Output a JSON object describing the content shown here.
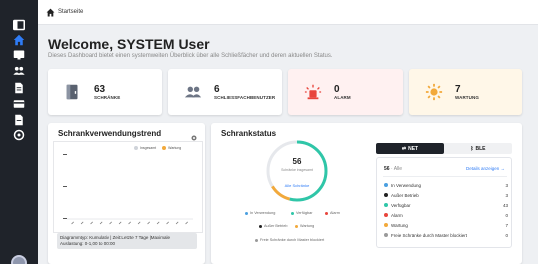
{
  "breadcrumb": {
    "home": "Startseite"
  },
  "header": {
    "title": "Welcome, SYSTEM User",
    "subtitle": "Dieses Dashboard bietet einen systemweiten Überblick über alle Schließfächer und deren aktuellen Status."
  },
  "stats": [
    {
      "value": "63",
      "label": "SCHRÄNKE",
      "icon": "locker-icon"
    },
    {
      "value": "6",
      "label": "SCHLIESSFACHBENUTZER",
      "icon": "users-icon"
    },
    {
      "value": "0",
      "label": "ALARM",
      "icon": "alarm-icon"
    },
    {
      "value": "7",
      "label": "WARTUNG",
      "icon": "maintenance-icon"
    }
  ],
  "trend": {
    "title": "Schrankverwendungstrend",
    "legend": [
      "Insgesamt",
      "Wartung"
    ],
    "note": "Diagrammtyp: Kumulativ | Zeit:Letzte 7 Tage |Maximale Auslastung: 0-1,00 to 00:00"
  },
  "status": {
    "title": "Schrankstatus",
    "donut_total": "56",
    "donut_sub": "Schränke insgesamt",
    "donut_link": "Alle Schränke",
    "donut_fraction_in_use": 0.05,
    "legend": [
      "In Verwendung",
      "Verfügbar",
      "Alarm",
      "Außer Betrieb",
      "Wartung",
      "Freie Schränke durch Master blockiert"
    ],
    "tabs": [
      "NET",
      "BLE"
    ],
    "box_count": "56",
    "box_label": "Alle",
    "details": "Details anzeigen →",
    "rows": [
      {
        "label": "In Verwendung",
        "value": "3",
        "color": "#4a9fe0"
      },
      {
        "label": "Außer Betrieb",
        "value": "3",
        "color": "#222222"
      },
      {
        "label": "Verfügbar",
        "value": "43",
        "color": "#2fc6a8"
      },
      {
        "label": "Alarm",
        "value": "0",
        "color": "#e8453c"
      },
      {
        "label": "Wartung",
        "value": "7",
        "color": "#f2a93b"
      },
      {
        "label": "Freie Schränke durch Master blockiert",
        "value": "0",
        "color": "#9a9a9a"
      }
    ]
  },
  "colors": {
    "accent": "#2f7cf6",
    "sidebar": "#1f232a",
    "teal": "#2fc6a8",
    "orange": "#f2a93b",
    "red": "#e8453c"
  }
}
